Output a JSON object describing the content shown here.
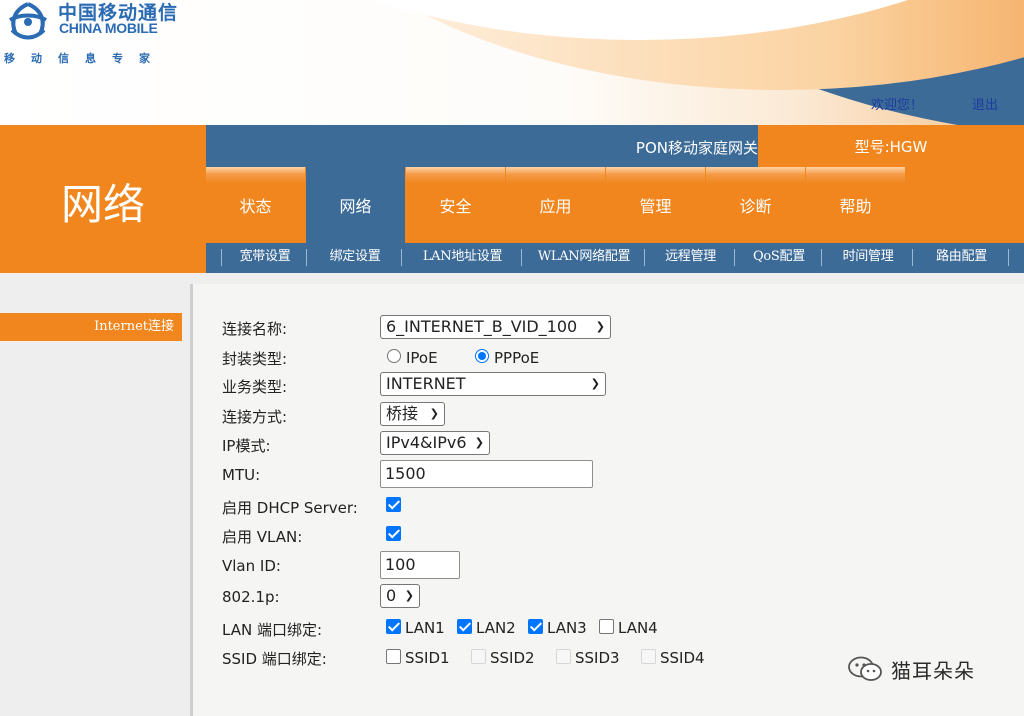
{
  "brand": {
    "logo_cn": "中国移动通信",
    "logo_en": "CHINA MOBILE",
    "slogan": "移动信息专家"
  },
  "header": {
    "welcome": "欢迎您！",
    "logout": "退出",
    "gateway_title": "PON移动家庭网关",
    "model": "型号:HGW"
  },
  "module_title": "网络",
  "main_tabs": [
    "状态",
    "网络",
    "安全",
    "应用",
    "管理",
    "诊断",
    "帮助"
  ],
  "active_main_tab": "网络",
  "sub_tabs": [
    "宽带设置",
    "绑定设置",
    "LAN地址设置",
    "WLAN网络配置",
    "远程管理",
    "QoS配置",
    "时间管理",
    "路由配置"
  ],
  "side_menu": {
    "item": "Internet连接"
  },
  "form": {
    "connection_name": {
      "label": "连接名称:",
      "value": "6_INTERNET_B_VID_100"
    },
    "encap_type": {
      "label": "封装类型:",
      "options": [
        "IPoE",
        "PPPoE"
      ],
      "selected": "PPPoE"
    },
    "service_type": {
      "label": "业务类型:",
      "value": "INTERNET"
    },
    "connect_mode": {
      "label": "连接方式:",
      "value": "桥接"
    },
    "ip_mode": {
      "label": "IP模式:",
      "value": "IPv4&IPv6"
    },
    "mtu": {
      "label": "MTU:",
      "value": "1500"
    },
    "dhcp_server": {
      "label": "启用 DHCP Server:",
      "checked": true
    },
    "vlan": {
      "label": "启用 VLAN:",
      "checked": true
    },
    "vlan_id": {
      "label": "Vlan ID:",
      "value": "100"
    },
    "dot1p": {
      "label": "802.1p:",
      "value": "0"
    },
    "lan_bind": {
      "label": "LAN 端口绑定:",
      "ports": [
        {
          "name": "LAN1",
          "checked": true
        },
        {
          "name": "LAN2",
          "checked": true
        },
        {
          "name": "LAN3",
          "checked": true
        },
        {
          "name": "LAN4",
          "checked": false
        }
      ]
    },
    "ssid_bind": {
      "label": "SSID 端口绑定:",
      "ports": [
        {
          "name": "SSID1",
          "checked": false,
          "disabled": false
        },
        {
          "name": "SSID2",
          "checked": false,
          "disabled": true
        },
        {
          "name": "SSID3",
          "checked": false,
          "disabled": true
        },
        {
          "name": "SSID4",
          "checked": false,
          "disabled": true
        }
      ]
    }
  },
  "watermark": {
    "text": "猫耳朵朵"
  },
  "icons": {
    "logo": "china-mobile-logo-icon",
    "watermark": "wechat-icon",
    "select_arrow": "chevron-down-icon"
  },
  "colors": {
    "orange": "#f0861d",
    "blue": "#3d6b98",
    "link": "#1a3d9c",
    "checkbox": "#0075ff"
  }
}
